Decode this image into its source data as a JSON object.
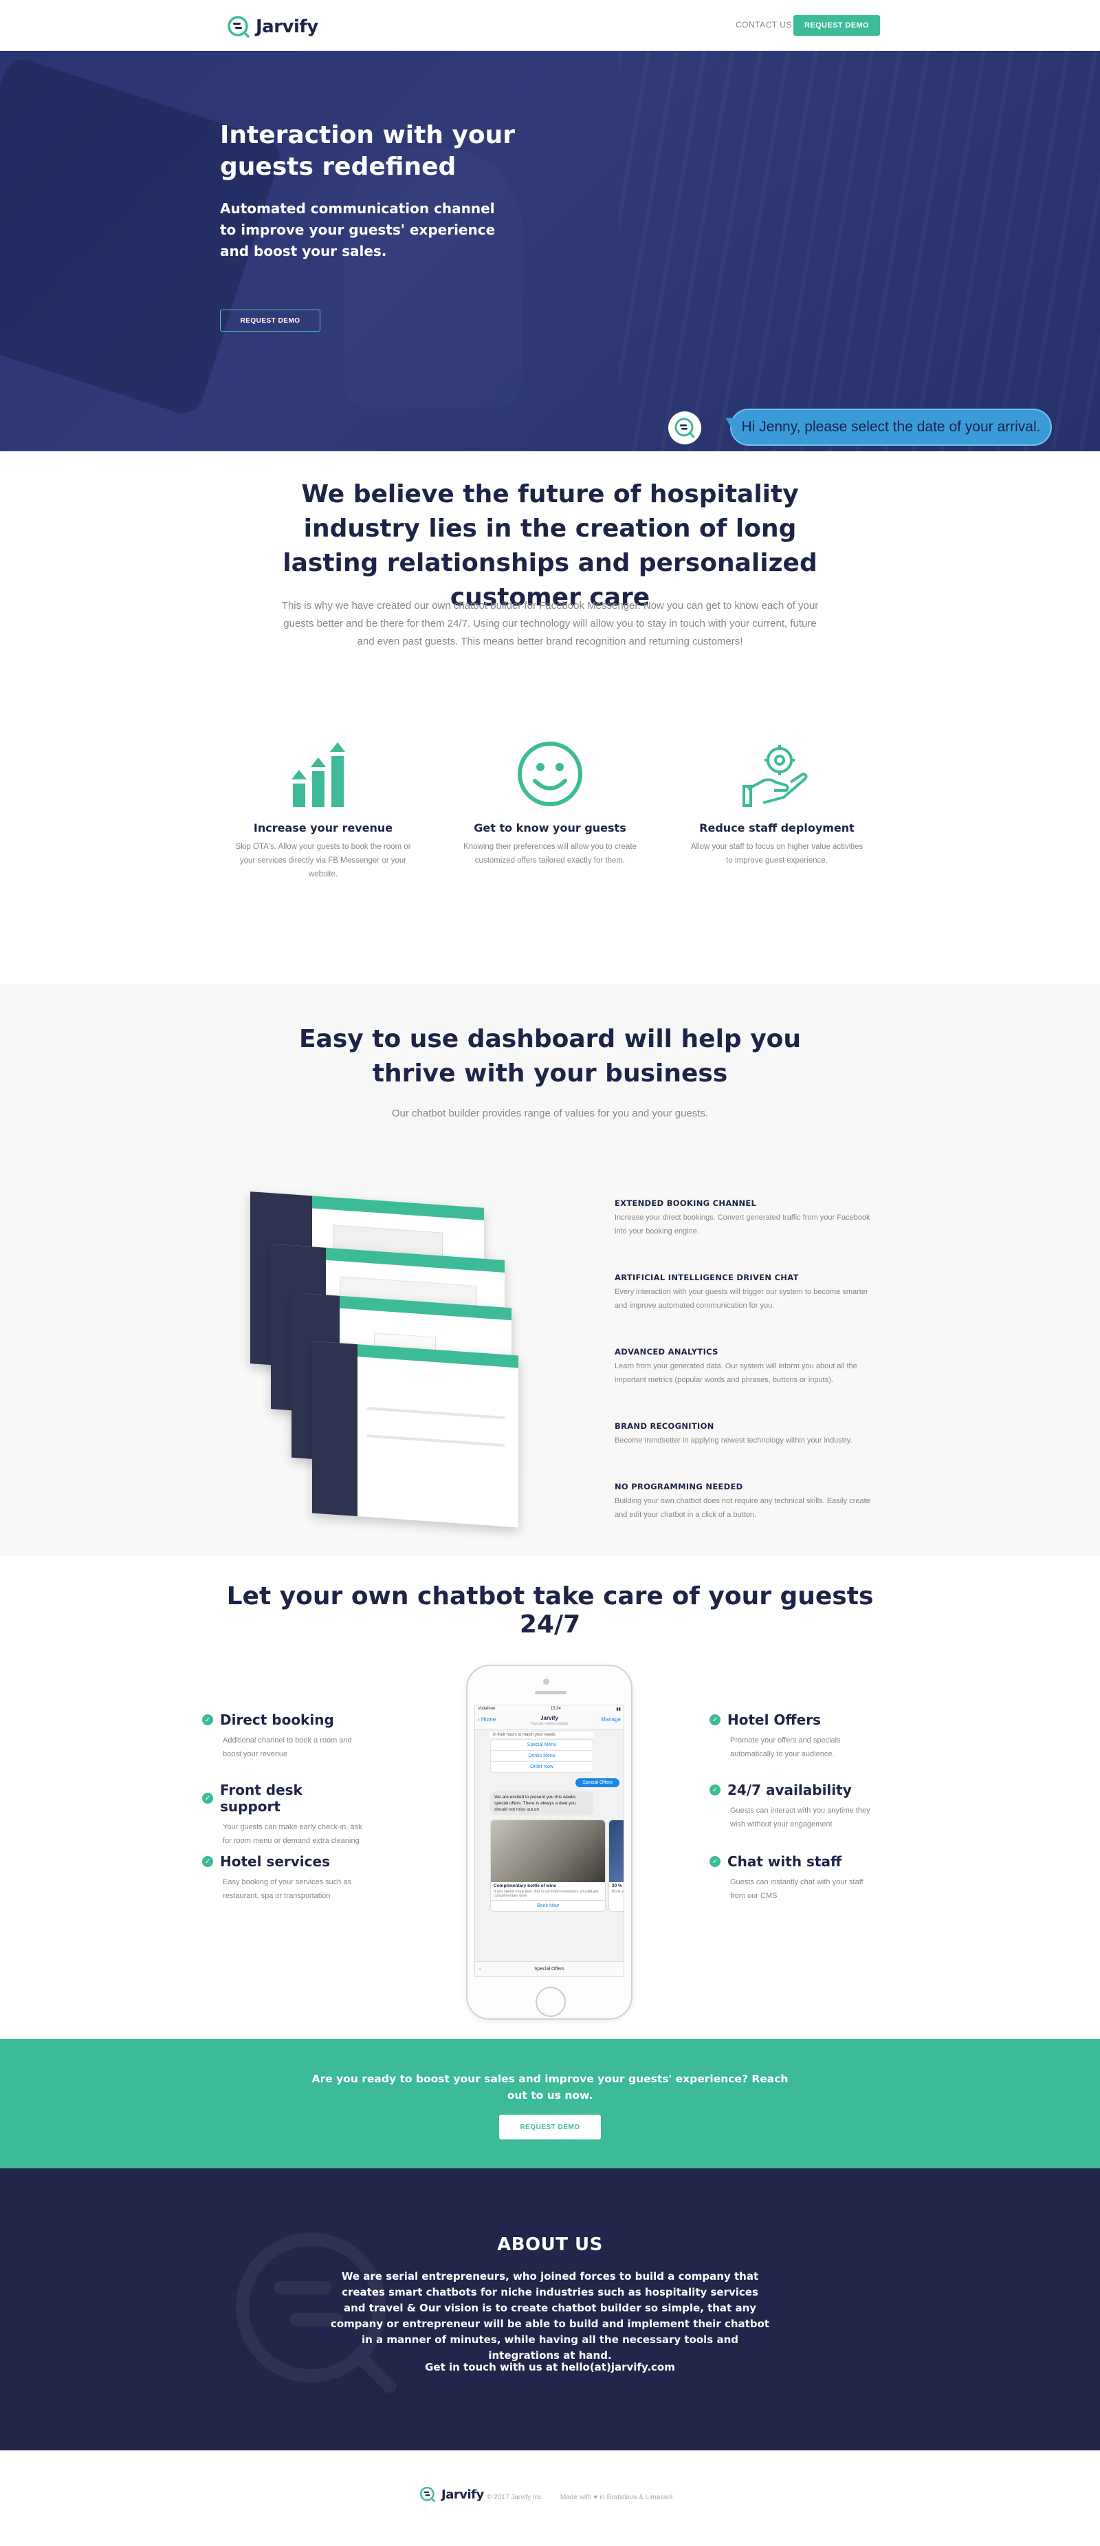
{
  "brand": {
    "name": "Jarvify",
    "accent": "#3dbb98",
    "navy": "#1e2448"
  },
  "header": {
    "contact_label": "CONTACT US",
    "demo_label": "REQUEST DEMO"
  },
  "hero": {
    "title": "Interaction with your guests redefined",
    "subtitle": "Automated communication channel to improve your guests' experience and boost your sales.",
    "cta_label": "REQUEST DEMO",
    "chat_message": "Hi Jenny, please select the date of your arrival."
  },
  "belief": {
    "title": "We believe the future of hospitality industry lies in the creation of long lasting relationships and personalized customer care",
    "body": "This is why we have created our own chatbot builder for Facebook Messenger. Now you can get to know each of your guests better and be there for them 24/7. Using our technology will allow you to stay in touch with your current, future and even past guests. This means better brand recognition and returning customers!"
  },
  "features": [
    {
      "icon": "revenue-bars-icon",
      "title": "Increase your revenue",
      "desc": "Skip OTA's. Allow your guests to book the room or your services directly via FB Messenger or your website."
    },
    {
      "icon": "smiley-icon",
      "title": "Get to know your guests",
      "desc": "Knowing their preferences will allow you to create customized offers tailored exactly for them."
    },
    {
      "icon": "hand-gear-icon",
      "title": "Reduce staff deployment",
      "desc": "Allow your staff to focus on higher value activities to improve guest experience."
    }
  ],
  "dashboard": {
    "title": "Easy to use dashboard will help you thrive with your business",
    "subtitle": "Our chatbot builder provides range of values for you and your guests.",
    "items": [
      {
        "title": "EXTENDED BOOKING CHANNEL",
        "desc": "Increase your direct bookings. Convert generated traffic from your Facebook into your booking engine."
      },
      {
        "title": "ARTIFICIAL INTELLIGENCE DRIVEN CHAT",
        "desc": "Every interaction with your guests will trigger our system to become smarter and improve automated communication for you."
      },
      {
        "title": "ADVANCED ANALYTICS",
        "desc": "Learn from your generated data. Our system will inform you about all the important metrics (popular words and phrases, buttons or inputs)."
      },
      {
        "title": "BRAND RECOGNITION",
        "desc": "Become trendsetter in applying newest technology within your industry."
      },
      {
        "title": "NO PROGRAMMING NEEDED",
        "desc": "Building your own chatbot does not require any technical skills. Easily create and edit your chatbot in a click of a button."
      }
    ]
  },
  "bot": {
    "title": "Let your own chatbot take care of your guests 24/7",
    "left": [
      {
        "title": "Direct booking",
        "desc": "Additional channel to book a room and boost your revenue"
      },
      {
        "title": "Front desk support",
        "desc": "Your guests can make early check-in, ask for room menu or demand extra cleaning"
      },
      {
        "title": "Hotel services",
        "desc": "Easy booking of your services such as restaurant, spa or transportation"
      }
    ],
    "right": [
      {
        "title": "Hotel Offers",
        "desc": "Promote your offers and specials automatically to your audience."
      },
      {
        "title": "24/7 availability",
        "desc": "Guests can interact with you anytime they wish without your engagement"
      },
      {
        "title": "Chat with staff",
        "desc": "Guests can instantly chat with your staff from our CMS"
      }
    ],
    "phone": {
      "carrier": "Vodafone",
      "time": "15:34",
      "back": "Home",
      "name": "Jarvify",
      "manage": "Manage",
      "sub": "Typically replies instantly",
      "intro": "in their hours to match your needs",
      "menu1": "Special Menu",
      "menu2": "Drinks Menu",
      "menu3": "Order Now",
      "user_msg": "Special Offers",
      "bot_msg": "We are excited to present you this weeks special offers. There is always a deal you should not miss out on",
      "card_title": "Complimentary bottle of wine",
      "card_desc": "If you spend more than 300 in our hotel restaurant, you will get complimentary wine",
      "card2_title": "30 % d",
      "card2_desc": "Book y",
      "book": "Book Now",
      "bottom": "Special Offers"
    }
  },
  "cta": {
    "text": "Are you ready to boost your sales and improve your guests' experience? Reach out to us now.",
    "button": "REQUEST DEMO"
  },
  "about": {
    "title": "ABOUT US",
    "body": "We are serial entrepreneurs, who joined forces to build a company that creates smart chatbots for niche industries such as hospitality services and travel & Our vision is to create chatbot builder so simple, that any company or entrepreneur will be able to build and implement their chatbot in a manner of minutes, while having all the necessary tools and integrations at hand.",
    "contact": "Get in touch with us at hello(at)jarvify.com"
  },
  "footer": {
    "copyright": "© 2017 Jarvify Inc.",
    "made": "Made with ♥ in Bratislava & Limassol"
  }
}
